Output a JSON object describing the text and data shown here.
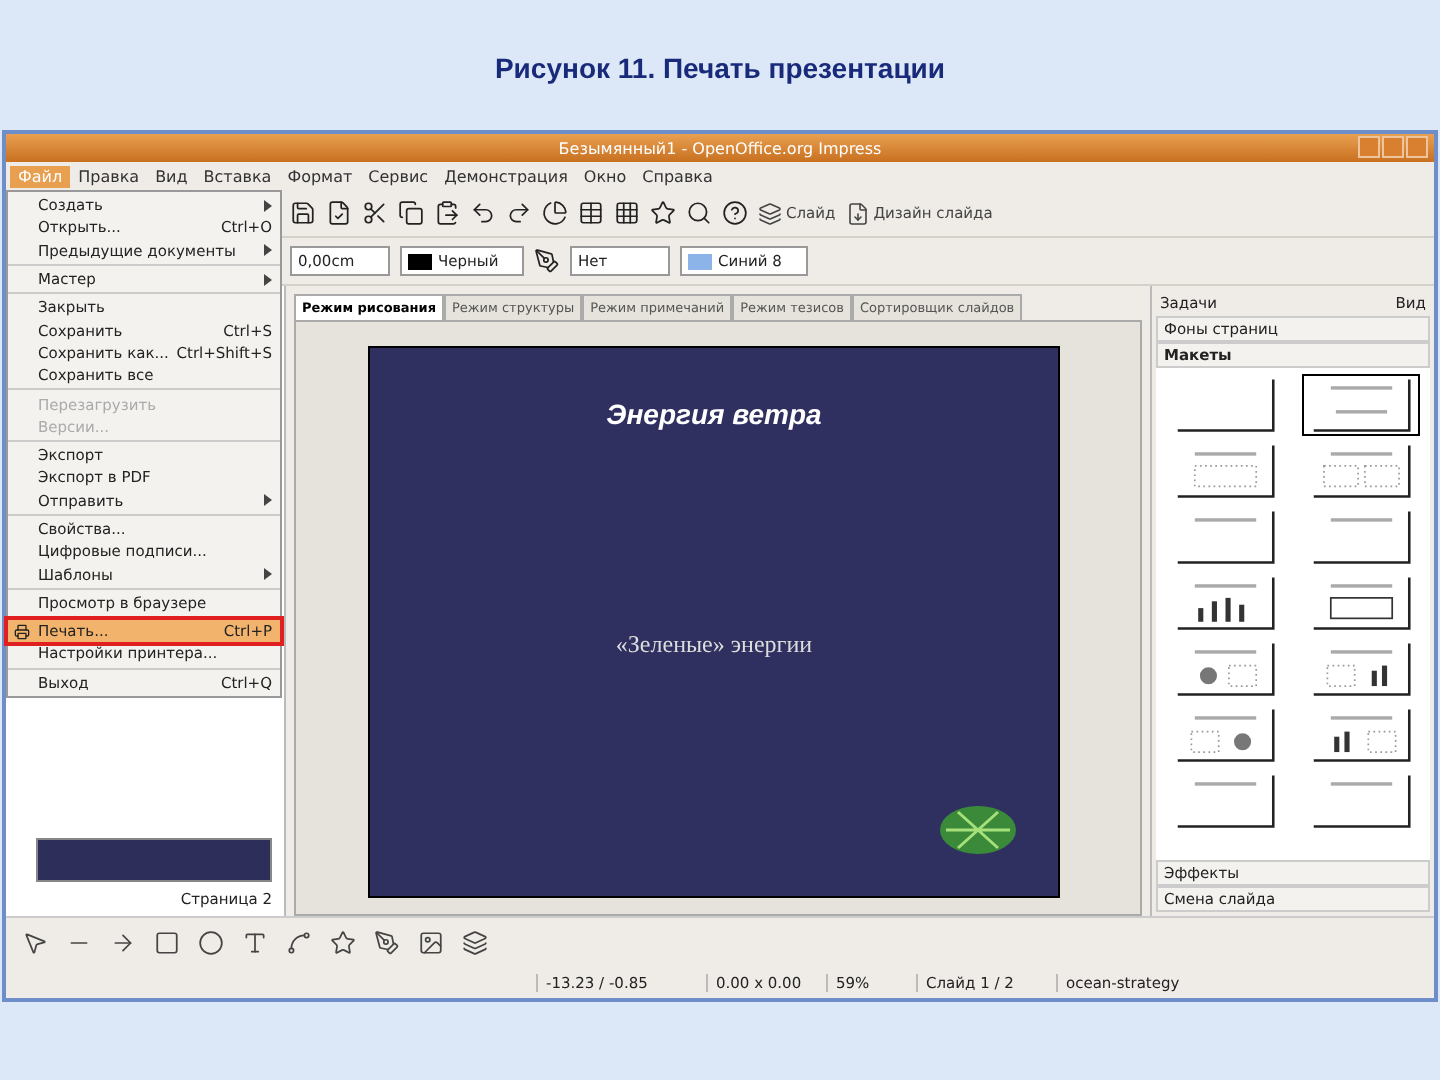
{
  "caption": "Рисунок 11. Печать презентации",
  "window": {
    "title": "Безымянный1 - OpenOffice.org Impress"
  },
  "menubar": [
    {
      "label": "Файл",
      "selected": true
    },
    {
      "label": "Правка",
      "selected": false
    },
    {
      "label": "Вид",
      "selected": false
    },
    {
      "label": "Вставка",
      "selected": false
    },
    {
      "label": "Формат",
      "selected": false
    },
    {
      "label": "Сервис",
      "selected": false
    },
    {
      "label": "Демонстрация",
      "selected": false
    },
    {
      "label": "Окно",
      "selected": false
    },
    {
      "label": "Справка",
      "selected": false
    }
  ],
  "file_menu": [
    {
      "kind": "item",
      "label": "Создать",
      "submenu": true,
      "disabled": false,
      "selected": false
    },
    {
      "kind": "item",
      "label": "Открыть...",
      "shortcut": "Ctrl+O",
      "submenu": false,
      "disabled": false,
      "selected": false
    },
    {
      "kind": "item",
      "label": "Предыдущие документы",
      "submenu": true,
      "disabled": false,
      "selected": false
    },
    {
      "kind": "separator"
    },
    {
      "kind": "item",
      "label": "Мастер",
      "submenu": true,
      "disabled": false,
      "selected": false
    },
    {
      "kind": "separator"
    },
    {
      "kind": "item",
      "label": "Закрыть",
      "submenu": false,
      "disabled": false,
      "selected": false
    },
    {
      "kind": "item",
      "label": "Сохранить",
      "shortcut": "Ctrl+S",
      "submenu": false,
      "disabled": false,
      "selected": false
    },
    {
      "kind": "item",
      "label": "Сохранить как...",
      "shortcut": "Ctrl+Shift+S",
      "submenu": false,
      "disabled": false,
      "selected": false
    },
    {
      "kind": "item",
      "label": "Сохранить все",
      "submenu": false,
      "disabled": false,
      "selected": false
    },
    {
      "kind": "separator"
    },
    {
      "kind": "item",
      "label": "Перезагрузить",
      "submenu": false,
      "disabled": true,
      "selected": false
    },
    {
      "kind": "item",
      "label": "Версии...",
      "submenu": false,
      "disabled": true,
      "selected": false
    },
    {
      "kind": "separator"
    },
    {
      "kind": "item",
      "label": "Экспорт",
      "submenu": false,
      "disabled": false,
      "selected": false
    },
    {
      "kind": "item",
      "label": "Экспорт в PDF",
      "submenu": false,
      "disabled": false,
      "selected": false
    },
    {
      "kind": "item",
      "label": "Отправить",
      "submenu": true,
      "disabled": false,
      "selected": false
    },
    {
      "kind": "separator"
    },
    {
      "kind": "item",
      "label": "Свойства...",
      "submenu": false,
      "disabled": false,
      "selected": false
    },
    {
      "kind": "item",
      "label": "Цифровые подписи...",
      "submenu": false,
      "disabled": false,
      "selected": false
    },
    {
      "kind": "item",
      "label": "Шаблоны",
      "submenu": true,
      "disabled": false,
      "selected": false
    },
    {
      "kind": "separator"
    },
    {
      "kind": "item",
      "label": "Просмотр в браузере",
      "submenu": false,
      "disabled": false,
      "selected": false
    },
    {
      "kind": "separator"
    },
    {
      "kind": "item",
      "label": "Печать...",
      "shortcut": "Ctrl+P",
      "submenu": false,
      "disabled": false,
      "selected": true
    },
    {
      "kind": "item",
      "label": "Настройки принтера...",
      "submenu": false,
      "disabled": false,
      "selected": false
    },
    {
      "kind": "separator"
    },
    {
      "kind": "item",
      "label": "Выход",
      "shortcut": "Ctrl+Q",
      "submenu": false,
      "disabled": false,
      "selected": false
    }
  ],
  "standard_toolbar": {
    "buttons": [
      "Слайд",
      "Дизайн слайда"
    ]
  },
  "line_toolbar": {
    "width": "0,00cm",
    "line_color": "Черный",
    "fill": "Нет",
    "fill_color": "Синий 8"
  },
  "view_tabs": [
    {
      "label": "Режим рисования",
      "selected": true
    },
    {
      "label": "Режим структуры",
      "selected": false
    },
    {
      "label": "Режим примечаний",
      "selected": false
    },
    {
      "label": "Режим тезисов",
      "selected": false
    },
    {
      "label": "Сортировщик слайдов",
      "selected": false
    }
  ],
  "slide_pane": {
    "page_label": "Страница 2"
  },
  "slide": {
    "title": "Энергия ветра",
    "subtitle": "«Зеленые» энергии"
  },
  "task_pane": {
    "title": "Задачи",
    "view": "Вид",
    "sections": [
      {
        "label": "Фоны страниц",
        "expanded": false
      },
      {
        "label": "Макеты",
        "expanded": true
      },
      {
        "label": "Эффекты",
        "expanded": false
      },
      {
        "label": "Смена слайда",
        "expanded": false
      }
    ],
    "layouts": [
      {
        "kind": "blank",
        "selected": false
      },
      {
        "kind": "title",
        "selected": true
      },
      {
        "kind": "list",
        "selected": false
      },
      {
        "kind": "two-list",
        "selected": false
      },
      {
        "kind": "title-only",
        "selected": false
      },
      {
        "kind": "title-only",
        "selected": false
      },
      {
        "kind": "chart",
        "selected": false
      },
      {
        "kind": "table",
        "selected": false
      },
      {
        "kind": "clipart-list",
        "selected": false
      },
      {
        "kind": "list-chart",
        "selected": false
      },
      {
        "kind": "list-clipart",
        "selected": false
      },
      {
        "kind": "chart-list",
        "selected": false
      },
      {
        "kind": "title-only",
        "selected": false
      },
      {
        "kind": "title-only",
        "selected": false
      }
    ]
  },
  "status_bar": {
    "position": "-13.23 / -0.85",
    "size": "0.00 x 0.00",
    "zoom": "59%",
    "slide": "Слайд 1 / 2",
    "design": "ocean-strategy"
  }
}
